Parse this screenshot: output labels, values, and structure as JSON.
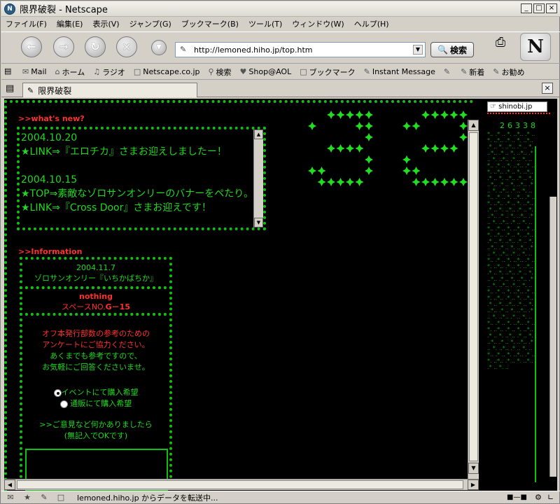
{
  "window": {
    "title": "限界破裂 - Netscape",
    "app_icon": "N"
  },
  "menu": [
    "ファイル(F)",
    "編集(E)",
    "表示(V)",
    "ジャンプ(G)",
    "ブックマーク(B)",
    "ツール(T)",
    "ウィンドウ(W)",
    "ヘルプ(H)"
  ],
  "nav": {
    "url": "http://lemoned.hiho.jp/top.htm",
    "search_label": "検索"
  },
  "personal_toolbar": [
    "Mail",
    "ホーム",
    "ラジオ",
    "Netscape.co.jp",
    "検索",
    "Shop@AOL",
    "ブックマーク",
    "Instant Message",
    "",
    "新着",
    "お勧め"
  ],
  "tab": {
    "title": "限界破裂"
  },
  "page": {
    "whats_new_heading": ">>what's new?",
    "news": [
      {
        "date": "2004.10.20",
        "text": "★LINK⇒『エロチカ』さまお迎えしましたー！"
      },
      {
        "date": "2004.10.15",
        "text": "★TOP⇒素敵なゾロサンオンリーのバナーをペたり。"
      },
      {
        "date": "",
        "text": "★LINK⇒『Cross Door』さまお迎えです！"
      }
    ],
    "info_heading": ">>Information",
    "event_date": "2004.11.7",
    "event_name": "ゾロサンオンリー『いちかばちか』",
    "circle_name": "nothing",
    "space_label": "スペースNO.",
    "space_no": "G－15",
    "survey_text": "オフ本発行部数の参考のための\nアンケートにご協力ください。",
    "survey_sub": "あくまでも参考ですので、\nお気軽にご回答くださいませ。",
    "radio_options": [
      "イベントにて購入希望",
      "通販にて購入希望"
    ],
    "comment_prompt": ">>ご意見など何かありましたら\n(無記入でOKです)",
    "ad_label": "shinobi.jp",
    "counter": "26338"
  },
  "status": {
    "text": "lemoned.hiho.jp からデータを転送中..."
  },
  "colors": {
    "accent_green": "#20d820",
    "accent_red": "#ff3030",
    "background": "#000000"
  }
}
